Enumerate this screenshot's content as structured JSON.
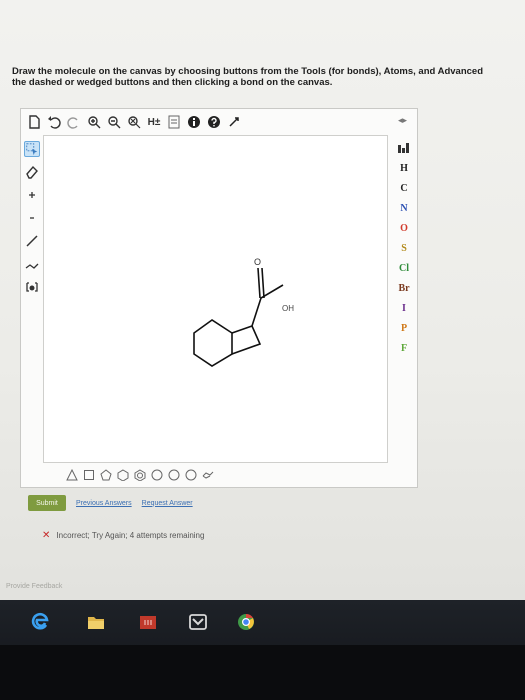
{
  "instructions": {
    "line1": "Draw the molecule on the canvas by choosing buttons from the Tools (for bonds), Atoms, and Advanced",
    "line2": "the dashed or wedged buttons and then clicking a bond on the canvas."
  },
  "toolbar": {
    "icons": [
      "new-document-icon",
      "undo-icon",
      "redo-icon",
      "zoom-in-icon",
      "zoom-out-icon",
      "zoom-reset-icon",
      "explicit-hydrogens-button",
      "templates-icon",
      "info-icon",
      "help-icon",
      "fullscreen-icon"
    ],
    "hydrogen_label": "H±",
    "panel_arrows": "◂▸"
  },
  "atoms": [
    "H",
    "C",
    "N",
    "O",
    "S",
    "Cl",
    "Br",
    "I",
    "P",
    "F"
  ],
  "molecule": {
    "labels": {
      "oxygen_double": "O",
      "hydroxyl": "OH"
    }
  },
  "actions": {
    "submit": "Submit",
    "previous_answers": "Previous Answers",
    "request_answer": "Request Answer"
  },
  "feedback": {
    "status": "Incorrect; Try Again; 4 attempts remaining"
  },
  "footer": {
    "provide_feedback": "Provide Feedback"
  },
  "colors": {
    "submit_green": "#7f9b3f",
    "link_blue": "#3b6fb3",
    "error_red": "#c62828",
    "selection_blue": "#6aa9dc"
  }
}
